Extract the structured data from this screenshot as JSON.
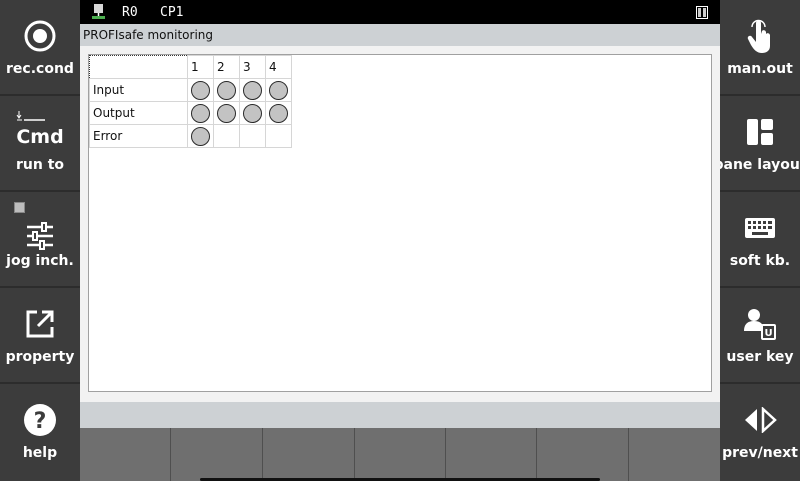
{
  "top_bar": {
    "robot": "R0",
    "program": "CP1",
    "icons": [
      "network-icon",
      "battery-icon"
    ]
  },
  "title": "PROFIsafe monitoring",
  "table": {
    "columns": [
      "1",
      "2",
      "3",
      "4"
    ],
    "rows": [
      {
        "label": "Input",
        "states": [
          "off",
          "off",
          "off",
          "off"
        ]
      },
      {
        "label": "Output",
        "states": [
          "off",
          "off",
          "off",
          "off"
        ]
      },
      {
        "label": "Error",
        "states": [
          "off",
          "",
          "",
          ""
        ]
      }
    ]
  },
  "colors": {
    "led_off": "#c3c3c3",
    "side_bg": "#3c3c3c",
    "title_bg": "#cdd1d4"
  },
  "left_buttons": [
    {
      "label": "rec.cond",
      "icon": "record-icon"
    },
    {
      "label": "run to",
      "cmd": "Cmd",
      "icon": "step-indicator-icon"
    },
    {
      "label": "jog inch.",
      "icon": "sliders-icon"
    },
    {
      "label": "property",
      "icon": "external-link-icon"
    },
    {
      "label": "help",
      "icon": "help-icon"
    }
  ],
  "right_buttons": [
    {
      "label": "man.out",
      "icon": "hand-pointer-icon"
    },
    {
      "label": "pane layout",
      "icon": "layout-icon"
    },
    {
      "label": "soft kb.",
      "icon": "keyboard-icon"
    },
    {
      "label": "user key",
      "icon": "user-key-icon"
    },
    {
      "label": "prev/next",
      "icon": "prev-next-icon"
    }
  ],
  "function_keys": [
    "",
    "",
    "",
    "",
    "",
    "",
    ""
  ]
}
